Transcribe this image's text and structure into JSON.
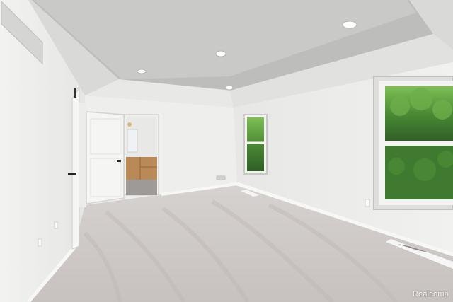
{
  "photo": {
    "watermark": "Realcomp"
  },
  "colors": {
    "wall": "#efefed",
    "wall_shadow": "#e2e2df",
    "ceiling": "#d8d8d6",
    "tray_ceiling": "#e4e4e2",
    "carpet": "#cfcac8",
    "trim": "#f4f4f2",
    "trees": "#4f8f3a",
    "cabinet": "#b98a58"
  }
}
